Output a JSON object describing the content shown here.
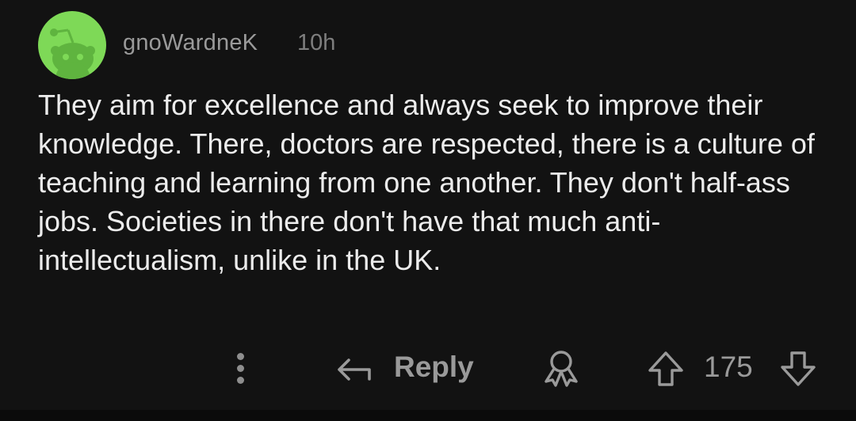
{
  "comment": {
    "username": "gnoWardneK",
    "time": "10h",
    "text": "They aim for excellence and always seek to improve their knowledge. There, doctors are respected, there is a culture of teaching and learning from one another. They don't half-ass jobs. Societies in there don't have that much anti-intellectualism, unlike in the UK.",
    "avatar_icon": "snoo-avatar-icon",
    "avatar_color": "#7ed957"
  },
  "actions": {
    "more_icon": "vertical-ellipsis-icon",
    "reply_icon": "reply-arrow-icon",
    "reply_label": "Reply",
    "award_icon": "award-icon",
    "upvote_icon": "upvote-arrow-icon",
    "vote_count": "175",
    "downvote_icon": "downvote-arrow-icon"
  }
}
